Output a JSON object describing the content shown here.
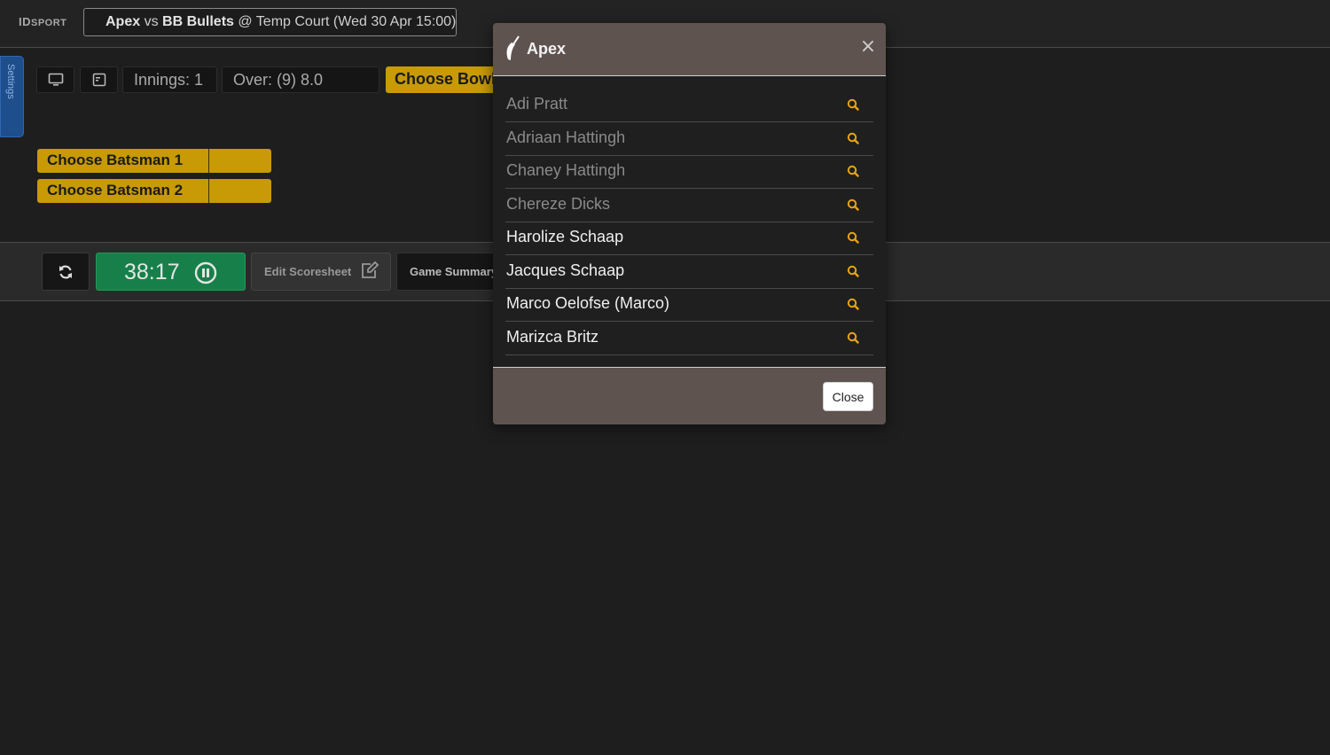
{
  "header": {
    "logo_main": "ID",
    "logo_small": "SPORT",
    "match": {
      "home": "Apex",
      "vs": "vs",
      "away": "BB Bullets",
      "venue_text": "@ Temp Court (Wed 30 Apr 15:00)"
    }
  },
  "settings_tab": {
    "label": "Settings"
  },
  "controls": {
    "innings": "Innings:  1",
    "over": "Over:  (9)  8.0",
    "choose_bowler": "Choose Bowler"
  },
  "batsmen": [
    {
      "label": "Choose Batsman 1"
    },
    {
      "label": "Choose Batsman 2"
    }
  ],
  "toolbar": {
    "timer": "38:17",
    "edit_scoresheet": "Edit Scoresheet",
    "game_summary": "Game Summary"
  },
  "modal": {
    "team_name": "Apex",
    "close_label": "Close",
    "players": [
      {
        "name": "Adi Pratt",
        "state": "dim"
      },
      {
        "name": "Adriaan Hattingh",
        "state": "dim"
      },
      {
        "name": "Chaney Hattingh",
        "state": "dim"
      },
      {
        "name": "Chereze Dicks",
        "state": "dim"
      },
      {
        "name": "Harolize Schaap",
        "state": "active"
      },
      {
        "name": "Jacques Schaap",
        "state": "active"
      },
      {
        "name": "Marco Oelofse (Marco)",
        "state": "active"
      },
      {
        "name": "Marizca Britz",
        "state": "active"
      }
    ]
  },
  "colors": {
    "accent_gold": "#c79a06",
    "timer_green": "#17804a",
    "modal_header": "#5f5350",
    "search_icon": "#e8a317"
  }
}
